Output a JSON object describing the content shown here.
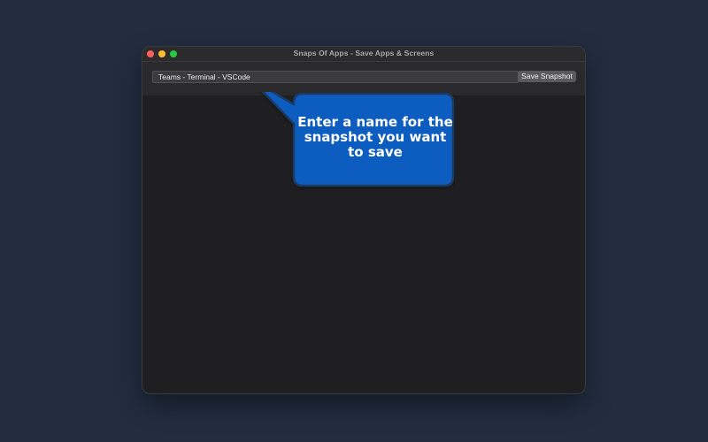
{
  "window": {
    "title": "Snaps Of Apps - Save Apps & Screens"
  },
  "toolbar": {
    "snapshot_name_value": "Teams - Terminal - VSCode",
    "save_label": "Save Snapshot"
  },
  "callout": {
    "text": "Enter a name for the snapshot you want to save"
  },
  "colors": {
    "desktop_background": "#222d40",
    "window_background": "#1f1f21",
    "callout_fill": "#0d5bbf",
    "callout_border": "#1d3a63"
  }
}
